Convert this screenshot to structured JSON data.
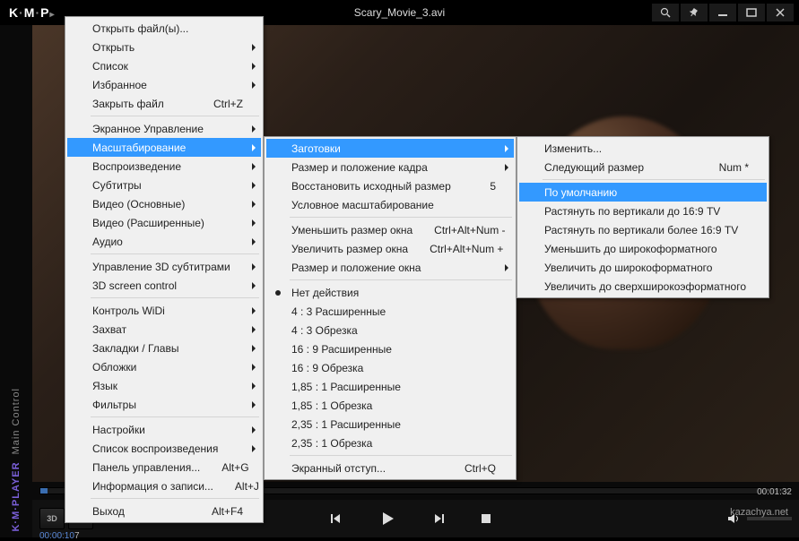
{
  "titlebar": {
    "logo1": "K",
    "logo2": "M",
    "logo3": "P",
    "title": "Scary_Movie_3.avi"
  },
  "sidebar": {
    "text1": "Main Control",
    "text2": "K·M·PLAYER"
  },
  "time": {
    "current": "00:00:10",
    "fragment": "7",
    "total": "00:01:32"
  },
  "btn3d": "3D",
  "watermark": "kazachya.net",
  "menu1": [
    {
      "type": "item",
      "label": "Открыть файл(ы)...",
      "sub": false
    },
    {
      "type": "item",
      "label": "Открыть",
      "sub": true
    },
    {
      "type": "item",
      "label": "Список",
      "sub": true
    },
    {
      "type": "item",
      "label": "Избранное",
      "sub": true
    },
    {
      "type": "item",
      "label": "Закрыть файл",
      "shortcut": "Ctrl+Z",
      "sub": false
    },
    {
      "type": "sep"
    },
    {
      "type": "item",
      "label": "Экранное Управление",
      "sub": true
    },
    {
      "type": "item",
      "label": "Масштабирование",
      "sub": true,
      "selected": true
    },
    {
      "type": "item",
      "label": "Воспроизведение",
      "sub": true
    },
    {
      "type": "item",
      "label": "Субтитры",
      "sub": true
    },
    {
      "type": "item",
      "label": "Видео (Основные)",
      "sub": true
    },
    {
      "type": "item",
      "label": "Видео (Расширенные)",
      "sub": true
    },
    {
      "type": "item",
      "label": "Аудио",
      "sub": true
    },
    {
      "type": "sep"
    },
    {
      "type": "item",
      "label": "Управление 3D субтитрами",
      "sub": true
    },
    {
      "type": "item",
      "label": "3D screen control",
      "sub": true
    },
    {
      "type": "sep"
    },
    {
      "type": "item",
      "label": "Контроль WiDi",
      "sub": true
    },
    {
      "type": "item",
      "label": "Захват",
      "sub": true
    },
    {
      "type": "item",
      "label": "Закладки / Главы",
      "sub": true
    },
    {
      "type": "item",
      "label": "Обложки",
      "sub": true
    },
    {
      "type": "item",
      "label": "Язык",
      "sub": true
    },
    {
      "type": "item",
      "label": "Фильтры",
      "sub": true
    },
    {
      "type": "sep"
    },
    {
      "type": "item",
      "label": "Настройки",
      "sub": true
    },
    {
      "type": "item",
      "label": "Список воспроизведения",
      "sub": true
    },
    {
      "type": "item",
      "label": "Панель управления...",
      "shortcut": "Alt+G",
      "sub": false
    },
    {
      "type": "item",
      "label": "Информация о записи...",
      "shortcut": "Alt+J",
      "sub": false
    },
    {
      "type": "sep"
    },
    {
      "type": "item",
      "label": "Выход",
      "shortcut": "Alt+F4",
      "sub": false
    }
  ],
  "menu2": [
    {
      "type": "item",
      "label": "Заготовки",
      "sub": true,
      "selected": true
    },
    {
      "type": "item",
      "label": "Размер и положение кадра",
      "sub": true
    },
    {
      "type": "item",
      "label": "Восстановить исходный размер",
      "shortcut": "5",
      "sub": false
    },
    {
      "type": "item",
      "label": "Условное масштабирование",
      "sub": false
    },
    {
      "type": "sep"
    },
    {
      "type": "item",
      "label": "Уменьшить размер окна",
      "shortcut": "Ctrl+Alt+Num -",
      "sub": false
    },
    {
      "type": "item",
      "label": "Увеличить размер окна",
      "shortcut": "Ctrl+Alt+Num +",
      "sub": false
    },
    {
      "type": "item",
      "label": "Размер и положение окна",
      "sub": true
    },
    {
      "type": "sep"
    },
    {
      "type": "item",
      "label": "Нет действия",
      "radio": true,
      "sub": false
    },
    {
      "type": "item",
      "label": "4 : 3  Расширенные",
      "sub": false
    },
    {
      "type": "item",
      "label": "4 : 3  Обрезка",
      "sub": false
    },
    {
      "type": "item",
      "label": "16 : 9  Расширенные",
      "sub": false
    },
    {
      "type": "item",
      "label": "16 : 9  Обрезка",
      "sub": false
    },
    {
      "type": "item",
      "label": "1,85 : 1  Расширенные",
      "sub": false
    },
    {
      "type": "item",
      "label": "1,85 : 1  Обрезка",
      "sub": false
    },
    {
      "type": "item",
      "label": "2,35 : 1  Расширенные",
      "sub": false
    },
    {
      "type": "item",
      "label": "2,35 : 1  Обрезка",
      "sub": false
    },
    {
      "type": "sep"
    },
    {
      "type": "item",
      "label": "Экранный отступ...",
      "shortcut": "Ctrl+Q",
      "sub": false
    }
  ],
  "menu3": [
    {
      "type": "item",
      "label": "Изменить...",
      "sub": false
    },
    {
      "type": "item",
      "label": "Следующий размер",
      "shortcut": "Num *",
      "sub": false
    },
    {
      "type": "sep"
    },
    {
      "type": "item",
      "label": "По умолчанию",
      "sub": false,
      "selected": true
    },
    {
      "type": "item",
      "label": "Растянуть по вертикали до 16:9 TV",
      "sub": false
    },
    {
      "type": "item",
      "label": "Растянуть по вертикали более 16:9 TV",
      "sub": false
    },
    {
      "type": "item",
      "label": "Уменьшить до широкоформатного",
      "sub": false
    },
    {
      "type": "item",
      "label": "Увеличить до широкоформатного",
      "sub": false
    },
    {
      "type": "item",
      "label": "Увеличить до сверхширокоэформатного",
      "sub": false
    }
  ]
}
